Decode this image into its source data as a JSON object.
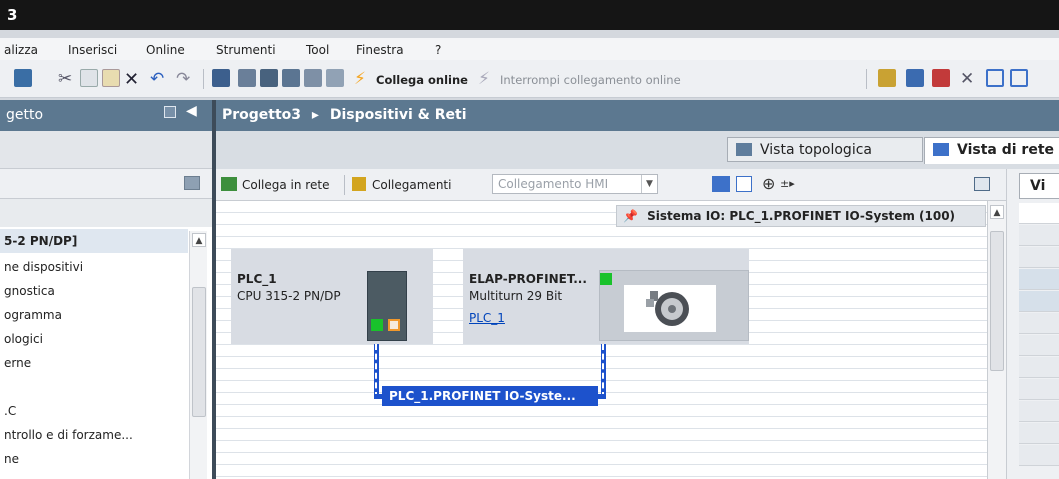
{
  "window": {
    "title_fragment": "3"
  },
  "menu": [
    "alizza",
    "Inserisci",
    "Online",
    "Strumenti",
    "Tool",
    "Finestra",
    "?"
  ],
  "toolbar": {
    "connect_online": "Collega online",
    "disconnect_online": "Interrompi collegamento online"
  },
  "project_panel": {
    "title": "getto",
    "items": [
      "5-2 PN/DP]",
      "ne dispositivi",
      "gnostica",
      "ogramma",
      "ologici",
      "erne",
      ".C",
      "ntrollo e di forzame...",
      "ne"
    ]
  },
  "breadcrumb": {
    "project": "Progetto3",
    "separator": "▸",
    "section": "Dispositivi & Reti"
  },
  "views": {
    "topology": "Vista topologica",
    "network": "Vista di rete"
  },
  "editor_toolbar": {
    "connect_network": "Collega in rete",
    "connections": "Collegamenti",
    "connection_type": "Collegamento HMI"
  },
  "io_system_banner": "Sistema IO: PLC_1.PROFINET IO-System (100)",
  "devices": {
    "plc": {
      "name": "PLC_1",
      "cpu": "CPU 315-2 PN/DP"
    },
    "encoder": {
      "name": "ELAP-PROFINET...",
      "model": "Multiturn 29 Bit",
      "controller_link": "PLC_1"
    }
  },
  "network_label": "PLC_1.PROFINET IO-Syste...",
  "right_panel": {
    "tab_label": "Vi"
  },
  "colors": {
    "header_bar": "#5c7890",
    "bus": "#1d52cc",
    "port_active": "#19c22b",
    "port_interface": "#f0982c",
    "connect_online_icon": "#f5a623"
  }
}
